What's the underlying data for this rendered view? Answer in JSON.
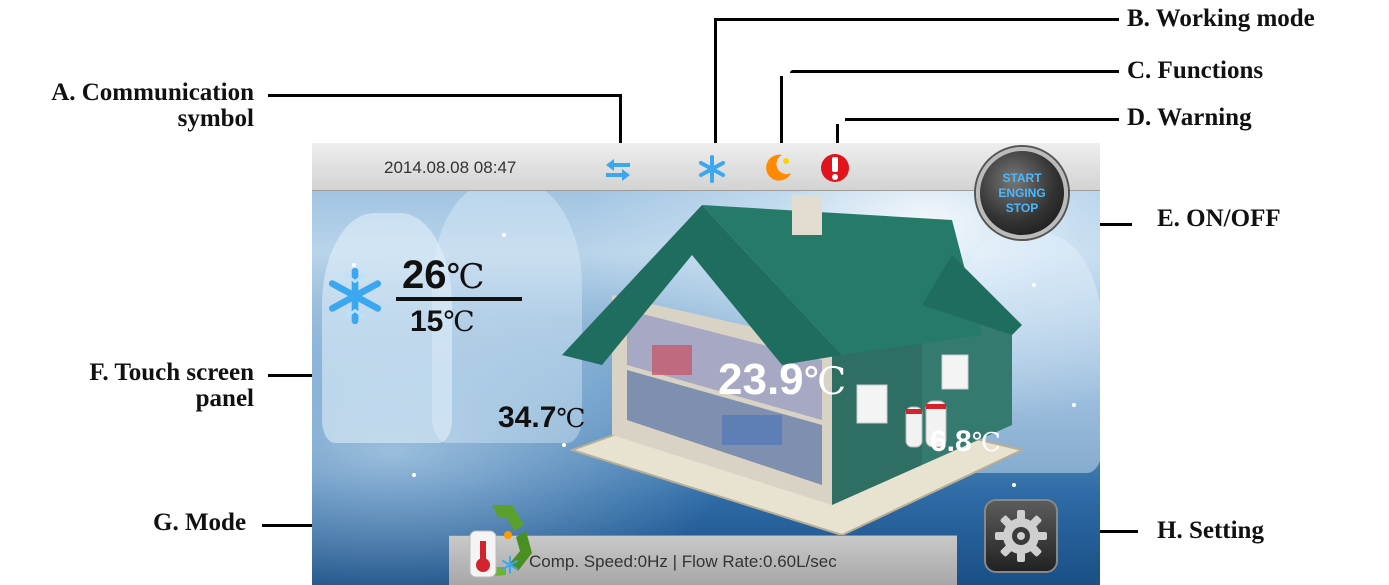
{
  "callouts": {
    "a_line1": "A.  Communication",
    "a_line2": "symbol",
    "b": "B. Working mode",
    "c": "C. Functions",
    "d": "D. Warning",
    "e": "E.  ON/OFF",
    "f_line1": "F. Touch screen",
    "f_line2": "panel",
    "g": "G. Mode",
    "h": "H. Setting"
  },
  "status_bar": {
    "datetime": "2014.08.08 08:47",
    "icons": [
      "communication-icon",
      "snowflake-icon",
      "function-moon-icon",
      "warning-icon"
    ]
  },
  "power_button": {
    "line1": "START",
    "line2": "ENGING",
    "line3": "STOP"
  },
  "setpoint": {
    "upper_value": "26",
    "lower_value": "15",
    "unit": "℃"
  },
  "readings": {
    "indoor": {
      "value": "23.9",
      "unit": "℃"
    },
    "water": {
      "value": "34.7",
      "unit": "℃"
    },
    "outdoor": {
      "value": "6.8",
      "unit": "℃"
    }
  },
  "info_bar": {
    "text": "Comp. Speed:0Hz | Flow Rate:0.60L/sec"
  },
  "colors": {
    "snow_blue": "#3aa7f0",
    "warning_red": "#e0141c",
    "function_orange": "#ff8a00",
    "button_text": "#49b8ff",
    "roof_green": "#1e6d5e"
  }
}
